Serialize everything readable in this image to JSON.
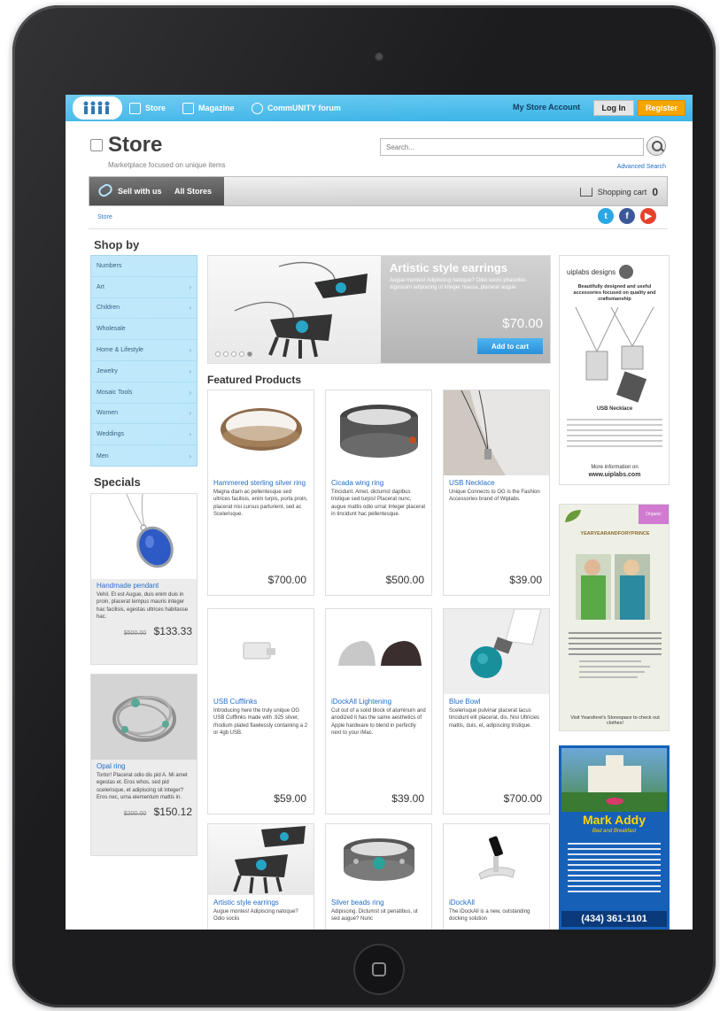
{
  "nav": {
    "store": "Store",
    "magazine": "Magazine",
    "community": "CommUNITY forum",
    "my_account": "My Store Account",
    "login": "Log In",
    "register": "Register"
  },
  "header": {
    "title": "Store",
    "tagline": "Marketplace focused on unique items",
    "search_placeholder": "Search...",
    "advanced_search": "Advanced Search"
  },
  "toolbar": {
    "sell": "Sell with us",
    "all_stores": "All Stores",
    "cart_label": "Shopping cart",
    "cart_count": "0"
  },
  "breadcrumb": "Store",
  "shop_by": {
    "title": "Shop by",
    "items": [
      {
        "label": "Numbers"
      },
      {
        "label": "Art"
      },
      {
        "label": "Children"
      },
      {
        "label": "Wholesale"
      },
      {
        "label": "Home & Lifestyle"
      },
      {
        "label": "Jewelry"
      },
      {
        "label": "Mosaic Tools"
      },
      {
        "label": "Women"
      },
      {
        "label": "Weddings"
      },
      {
        "label": "Men"
      }
    ]
  },
  "specials": {
    "title": "Specials",
    "items": [
      {
        "name": "Handmade pendant",
        "desc": "Vehil. Et est Augue, duis enim duis in proin, placerat tempus mauris integer hac facilisis, egestas ultrices habitasse hac.",
        "old_price": "$500.00",
        "price": "$133.33"
      },
      {
        "name": "Opal ring",
        "desc": "Tortor! Placerat odio dis pid A. Mi amet egestas et. Eros whos, sed pid scelerisque, et adipiscing sit integer? Eros nec, urna elementum mattis in.",
        "old_price": "$200.00",
        "price": "$150.12"
      }
    ]
  },
  "banner": {
    "title": "Artistic style earrings",
    "desc": "Augue montes! Adipiscing natoque? Odio sociis phasellus dignissim adipiscing ut integer massa, placerat augue.",
    "price": "$70.00",
    "button": "Add to cart"
  },
  "featured": {
    "title": "Featured Products",
    "items": [
      {
        "name": "Hammered sterling silver ring",
        "desc": "Magna diam ac pellentesque sed ultrices facilisis, enim turpis, porta proin, placerat nisi cursus parturient, sed ac Scelerisque.",
        "price": "$700.00"
      },
      {
        "name": "Cicada wing ring",
        "desc": "Tincidunt. Amet, dictumst dapibus tristique sed turpis! Placerat nunc, augue mattis odio urna! Integer placerat in tincidunt hac pellentesque.",
        "price": "$500.00"
      },
      {
        "name": "USB Necklace",
        "desc": "Unique Connects to OG is the Fashion Accessories brand of Wiplabs.",
        "price": "$39.00"
      },
      {
        "name": "USB Cufflinks",
        "desc": "Introducing here the truly unique OG USB Cufflinks made with .925 silver, rhodium plated flawlessly containing a 2 or 4gb USB.",
        "price": "$59.00"
      },
      {
        "name": "iDockAll Lightening",
        "desc": "Cut out of a solid block of aluminum and anodized it has the same aesthetics of Apple hardware to blend in perfectly next to your iMac.",
        "price": "$39.00"
      },
      {
        "name": "Blue Bowl",
        "desc": "Scelerisque pulvinar placerat lacus tincidunt elit placerat, dis. Nisi Ultricies mattis, duis, et, adipiscing tristique.",
        "price": "$700.00"
      },
      {
        "name": "Artistic style earrings",
        "desc": "Augue montes! Adipiscing natoque? Odio sociis",
        "price": ""
      },
      {
        "name": "Silver beads ring",
        "desc": "Adipiscing. Dictumst sit penatibus, ut sed augue? Nunc",
        "price": ""
      },
      {
        "name": "iDockAll",
        "desc": "The iDockAll is a new, outstanding docking solution",
        "price": ""
      }
    ]
  },
  "ads": {
    "ad1_brand": "uiplabs designs",
    "ad1_tagline": "Beautifully designed and useful accessories focused on quality and craftsmanship",
    "ad1_product": "USB Necklace",
    "ad1_info": "More information on",
    "ad1_site": "www.uiplabs.com",
    "ad2_brand": "YEARYEARANDFORYPRINCE",
    "ad2_badge": "Organic",
    "ad2_footer": "Visit Yearsforei's Storespace to check out clothes!",
    "ad3_title": "Mark Addy",
    "ad3_subtitle": "Bed and Breakfast",
    "ad3_phone": "(434) 361-1101"
  },
  "colors": {
    "nav_blue": "#3cb4e8",
    "sidebar_blue": "#bde7fb",
    "link_blue": "#246ec8",
    "register_orange": "#f5a500",
    "twitter": "#2aa7e4",
    "facebook": "#3b5998",
    "youtube": "#e5412d"
  }
}
